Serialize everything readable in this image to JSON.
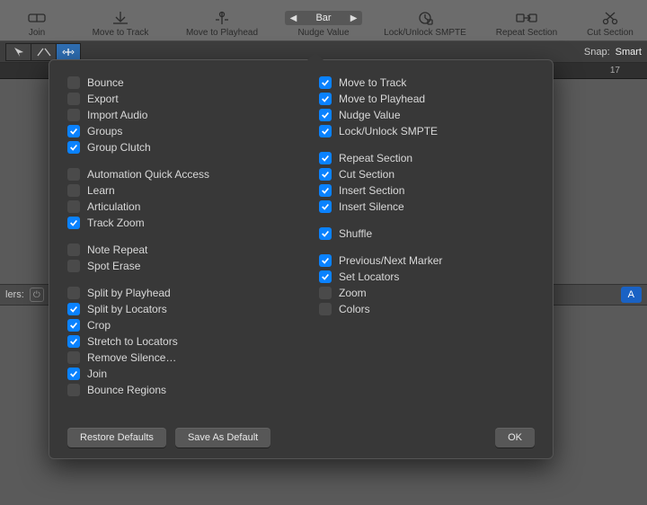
{
  "toolbar": {
    "join": "Join",
    "move_to_track": "Move to Track",
    "move_to_playhead": "Move to Playhead",
    "nudge_value": "Nudge Value",
    "nudge_value_current": "Bar",
    "lock_unlock_smpte": "Lock/Unlock SMPTE",
    "repeat_section": "Repeat Section",
    "cut_section": "Cut Section"
  },
  "secondbar": {
    "snap_label": "Snap:",
    "snap_value": "Smart"
  },
  "ruler": {
    "marker": "17"
  },
  "sidebar_row": {
    "label_suffix": "lers:",
    "button_A": "A"
  },
  "panel": {
    "col1": {
      "g1": [
        {
          "label": "Bounce",
          "on": false
        },
        {
          "label": "Export",
          "on": false
        },
        {
          "label": "Import Audio",
          "on": false
        },
        {
          "label": "Groups",
          "on": true
        },
        {
          "label": "Group Clutch",
          "on": true
        }
      ],
      "g2": [
        {
          "label": "Automation Quick Access",
          "on": false
        },
        {
          "label": "Learn",
          "on": false
        },
        {
          "label": "Articulation",
          "on": false
        },
        {
          "label": "Track Zoom",
          "on": true
        }
      ],
      "g3": [
        {
          "label": "Note Repeat",
          "on": false
        },
        {
          "label": "Spot Erase",
          "on": false
        }
      ],
      "g4": [
        {
          "label": "Split by Playhead",
          "on": false
        },
        {
          "label": "Split by Locators",
          "on": true
        },
        {
          "label": "Crop",
          "on": true
        },
        {
          "label": "Stretch to Locators",
          "on": true
        },
        {
          "label": "Remove Silence…",
          "on": false
        },
        {
          "label": "Join",
          "on": true
        },
        {
          "label": "Bounce Regions",
          "on": false
        }
      ]
    },
    "col2": {
      "g1": [
        {
          "label": "Move to Track",
          "on": true
        },
        {
          "label": "Move to Playhead",
          "on": true
        },
        {
          "label": "Nudge Value",
          "on": true
        },
        {
          "label": "Lock/Unlock SMPTE",
          "on": true
        }
      ],
      "g2": [
        {
          "label": "Repeat Section",
          "on": true
        },
        {
          "label": "Cut Section",
          "on": true
        },
        {
          "label": "Insert Section",
          "on": true
        },
        {
          "label": "Insert Silence",
          "on": true
        }
      ],
      "g3": [
        {
          "label": "Shuffle",
          "on": true
        }
      ],
      "g4": [
        {
          "label": "Previous/Next Marker",
          "on": true
        },
        {
          "label": "Set Locators",
          "on": true
        },
        {
          "label": "Zoom",
          "on": false
        },
        {
          "label": "Colors",
          "on": false
        }
      ]
    },
    "footer": {
      "restore": "Restore Defaults",
      "save_default": "Save As Default",
      "ok": "OK"
    }
  }
}
